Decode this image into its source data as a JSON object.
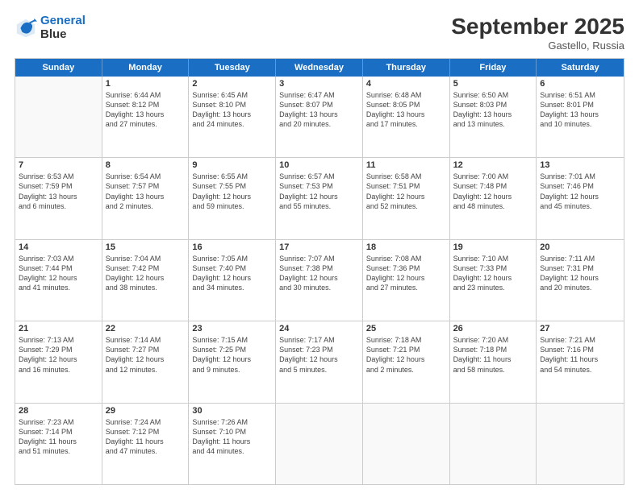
{
  "logo": {
    "line1": "General",
    "line2": "Blue"
  },
  "title": "September 2025",
  "subtitle": "Gastello, Russia",
  "header_days": [
    "Sunday",
    "Monday",
    "Tuesday",
    "Wednesday",
    "Thursday",
    "Friday",
    "Saturday"
  ],
  "weeks": [
    [
      {
        "day": "",
        "info": ""
      },
      {
        "day": "1",
        "info": "Sunrise: 6:44 AM\nSunset: 8:12 PM\nDaylight: 13 hours\nand 27 minutes."
      },
      {
        "day": "2",
        "info": "Sunrise: 6:45 AM\nSunset: 8:10 PM\nDaylight: 13 hours\nand 24 minutes."
      },
      {
        "day": "3",
        "info": "Sunrise: 6:47 AM\nSunset: 8:07 PM\nDaylight: 13 hours\nand 20 minutes."
      },
      {
        "day": "4",
        "info": "Sunrise: 6:48 AM\nSunset: 8:05 PM\nDaylight: 13 hours\nand 17 minutes."
      },
      {
        "day": "5",
        "info": "Sunrise: 6:50 AM\nSunset: 8:03 PM\nDaylight: 13 hours\nand 13 minutes."
      },
      {
        "day": "6",
        "info": "Sunrise: 6:51 AM\nSunset: 8:01 PM\nDaylight: 13 hours\nand 10 minutes."
      }
    ],
    [
      {
        "day": "7",
        "info": "Sunrise: 6:53 AM\nSunset: 7:59 PM\nDaylight: 13 hours\nand 6 minutes."
      },
      {
        "day": "8",
        "info": "Sunrise: 6:54 AM\nSunset: 7:57 PM\nDaylight: 13 hours\nand 2 minutes."
      },
      {
        "day": "9",
        "info": "Sunrise: 6:55 AM\nSunset: 7:55 PM\nDaylight: 12 hours\nand 59 minutes."
      },
      {
        "day": "10",
        "info": "Sunrise: 6:57 AM\nSunset: 7:53 PM\nDaylight: 12 hours\nand 55 minutes."
      },
      {
        "day": "11",
        "info": "Sunrise: 6:58 AM\nSunset: 7:51 PM\nDaylight: 12 hours\nand 52 minutes."
      },
      {
        "day": "12",
        "info": "Sunrise: 7:00 AM\nSunset: 7:48 PM\nDaylight: 12 hours\nand 48 minutes."
      },
      {
        "day": "13",
        "info": "Sunrise: 7:01 AM\nSunset: 7:46 PM\nDaylight: 12 hours\nand 45 minutes."
      }
    ],
    [
      {
        "day": "14",
        "info": "Sunrise: 7:03 AM\nSunset: 7:44 PM\nDaylight: 12 hours\nand 41 minutes."
      },
      {
        "day": "15",
        "info": "Sunrise: 7:04 AM\nSunset: 7:42 PM\nDaylight: 12 hours\nand 38 minutes."
      },
      {
        "day": "16",
        "info": "Sunrise: 7:05 AM\nSunset: 7:40 PM\nDaylight: 12 hours\nand 34 minutes."
      },
      {
        "day": "17",
        "info": "Sunrise: 7:07 AM\nSunset: 7:38 PM\nDaylight: 12 hours\nand 30 minutes."
      },
      {
        "day": "18",
        "info": "Sunrise: 7:08 AM\nSunset: 7:36 PM\nDaylight: 12 hours\nand 27 minutes."
      },
      {
        "day": "19",
        "info": "Sunrise: 7:10 AM\nSunset: 7:33 PM\nDaylight: 12 hours\nand 23 minutes."
      },
      {
        "day": "20",
        "info": "Sunrise: 7:11 AM\nSunset: 7:31 PM\nDaylight: 12 hours\nand 20 minutes."
      }
    ],
    [
      {
        "day": "21",
        "info": "Sunrise: 7:13 AM\nSunset: 7:29 PM\nDaylight: 12 hours\nand 16 minutes."
      },
      {
        "day": "22",
        "info": "Sunrise: 7:14 AM\nSunset: 7:27 PM\nDaylight: 12 hours\nand 12 minutes."
      },
      {
        "day": "23",
        "info": "Sunrise: 7:15 AM\nSunset: 7:25 PM\nDaylight: 12 hours\nand 9 minutes."
      },
      {
        "day": "24",
        "info": "Sunrise: 7:17 AM\nSunset: 7:23 PM\nDaylight: 12 hours\nand 5 minutes."
      },
      {
        "day": "25",
        "info": "Sunrise: 7:18 AM\nSunset: 7:21 PM\nDaylight: 12 hours\nand 2 minutes."
      },
      {
        "day": "26",
        "info": "Sunrise: 7:20 AM\nSunset: 7:18 PM\nDaylight: 11 hours\nand 58 minutes."
      },
      {
        "day": "27",
        "info": "Sunrise: 7:21 AM\nSunset: 7:16 PM\nDaylight: 11 hours\nand 54 minutes."
      }
    ],
    [
      {
        "day": "28",
        "info": "Sunrise: 7:23 AM\nSunset: 7:14 PM\nDaylight: 11 hours\nand 51 minutes."
      },
      {
        "day": "29",
        "info": "Sunrise: 7:24 AM\nSunset: 7:12 PM\nDaylight: 11 hours\nand 47 minutes."
      },
      {
        "day": "30",
        "info": "Sunrise: 7:26 AM\nSunset: 7:10 PM\nDaylight: 11 hours\nand 44 minutes."
      },
      {
        "day": "",
        "info": ""
      },
      {
        "day": "",
        "info": ""
      },
      {
        "day": "",
        "info": ""
      },
      {
        "day": "",
        "info": ""
      }
    ]
  ]
}
